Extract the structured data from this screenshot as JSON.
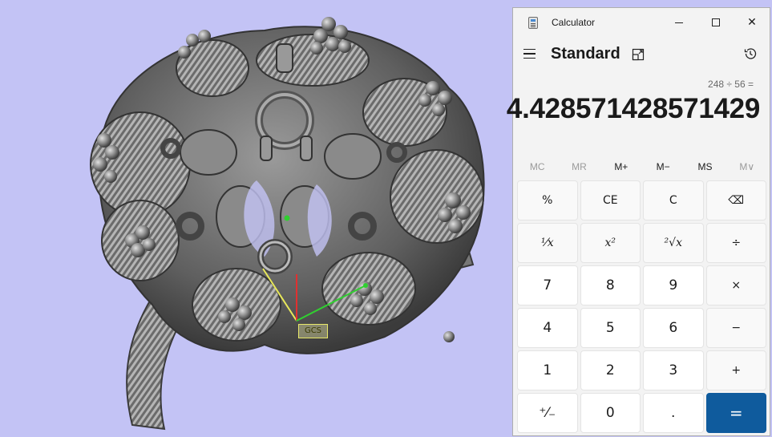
{
  "viewport": {
    "background_color": "#c3c3f5",
    "axis_label": "GCS"
  },
  "calculator": {
    "window_title": "Calculator",
    "window_buttons": {
      "minimize": "minimize",
      "maximize": "maximize",
      "close": "✕"
    },
    "mode": "Standard",
    "expression": "248 ÷ 56 =",
    "display": "4.428571428571429",
    "memory_buttons": [
      {
        "label": "MC",
        "enabled": false
      },
      {
        "label": "MR",
        "enabled": false
      },
      {
        "label": "M+",
        "enabled": true
      },
      {
        "label": "M−",
        "enabled": true
      },
      {
        "label": "MS",
        "enabled": true
      },
      {
        "label": "M∨",
        "enabled": false
      }
    ],
    "keys": [
      {
        "label": "%",
        "kind": "fn",
        "name": "percent"
      },
      {
        "label": "CE",
        "kind": "fn",
        "name": "clear-entry"
      },
      {
        "label": "C",
        "kind": "fn",
        "name": "clear"
      },
      {
        "label": "⌫",
        "kind": "fn",
        "name": "backspace"
      },
      {
        "label": "¹⁄x",
        "kind": "fn",
        "name": "reciprocal"
      },
      {
        "label": "x²",
        "kind": "fn",
        "name": "square"
      },
      {
        "label": "²√x",
        "kind": "fn",
        "name": "square-root"
      },
      {
        "label": "÷",
        "kind": "fn",
        "name": "divide"
      },
      {
        "label": "7",
        "kind": "num",
        "name": "seven"
      },
      {
        "label": "8",
        "kind": "num",
        "name": "eight"
      },
      {
        "label": "9",
        "kind": "num",
        "name": "nine"
      },
      {
        "label": "×",
        "kind": "fn",
        "name": "multiply"
      },
      {
        "label": "4",
        "kind": "num",
        "name": "four"
      },
      {
        "label": "5",
        "kind": "num",
        "name": "five"
      },
      {
        "label": "6",
        "kind": "num",
        "name": "six"
      },
      {
        "label": "−",
        "kind": "fn",
        "name": "subtract"
      },
      {
        "label": "1",
        "kind": "num",
        "name": "one"
      },
      {
        "label": "2",
        "kind": "num",
        "name": "two"
      },
      {
        "label": "3",
        "kind": "num",
        "name": "three"
      },
      {
        "label": "+",
        "kind": "fn",
        "name": "add"
      },
      {
        "label": "⁺⁄₋",
        "kind": "num",
        "name": "negate"
      },
      {
        "label": "0",
        "kind": "num",
        "name": "zero"
      },
      {
        "label": ".",
        "kind": "num",
        "name": "decimal"
      },
      {
        "label": "=",
        "kind": "eq",
        "name": "equals"
      }
    ],
    "accent_color": "#0f5b9d"
  }
}
